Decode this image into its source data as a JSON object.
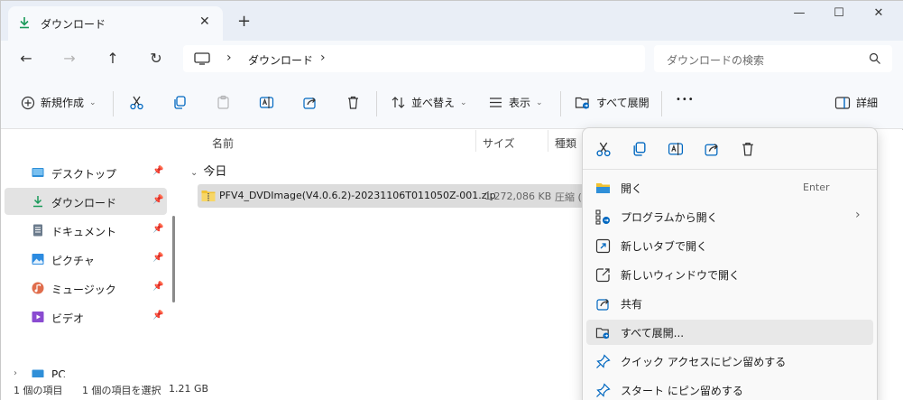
{
  "window": {
    "tab_title": "ダウンロード",
    "close_tab_glyph": "✕",
    "new_tab_glyph": "+",
    "minimize_glyph": "—",
    "maximize_glyph": "☐",
    "close_glyph": "✕"
  },
  "nav": {
    "back_glyph": "←",
    "forward_glyph": "→",
    "up_glyph": "↑",
    "refresh_glyph": "↻",
    "breadcrumb": "ダウンロード",
    "chevron": "›",
    "search_placeholder": "ダウンロードの検索"
  },
  "commandbar": {
    "new_label": "新規作成",
    "sort_label": "並べ替え",
    "view_label": "表示",
    "extract_all_label": "すべて展開",
    "more_glyph": "•••",
    "details_label": "詳細",
    "caret": "⌄"
  },
  "sidebar": {
    "items": [
      {
        "label": "デスクトップ",
        "icon": "desktop-icon"
      },
      {
        "label": "ダウンロード",
        "icon": "download-icon"
      },
      {
        "label": "ドキュメント",
        "icon": "document-icon"
      },
      {
        "label": "ピクチャ",
        "icon": "pictures-icon"
      },
      {
        "label": "ミュージック",
        "icon": "music-icon"
      },
      {
        "label": "ビデオ",
        "icon": "video-icon"
      },
      {
        "label": "PC",
        "icon": "pc-icon"
      }
    ],
    "pin_glyph": "📌",
    "expand_glyph": "›"
  },
  "columns": {
    "name": "名前",
    "size": "サイズ",
    "type": "種類"
  },
  "group": {
    "label": "今日",
    "caret": "⌄"
  },
  "file": {
    "name": "PFV4_DVDImage(V4.0.6.2)-20231106T011050Z-001.zip",
    "size": "1,272,086 KB",
    "type": "圧縮 ("
  },
  "status": {
    "count": "1 個の項目",
    "selected": "1 個の項目を選択",
    "size": "1.21 GB"
  },
  "context_menu": {
    "items": [
      {
        "label": "開く",
        "shortcut": "Enter"
      },
      {
        "label": "プログラムから開く",
        "submenu": "›"
      },
      {
        "label": "新しいタブで開く"
      },
      {
        "label": "新しいウィンドウで開く"
      },
      {
        "label": "共有"
      },
      {
        "label": "すべて展開..."
      },
      {
        "label": "クイック アクセスにピン留めする"
      },
      {
        "label": "スタート にピン留めする"
      }
    ]
  },
  "colors": {
    "accent": "#0067c0",
    "folder": "#f1c232",
    "selected_bg": "#dcdcdc"
  }
}
